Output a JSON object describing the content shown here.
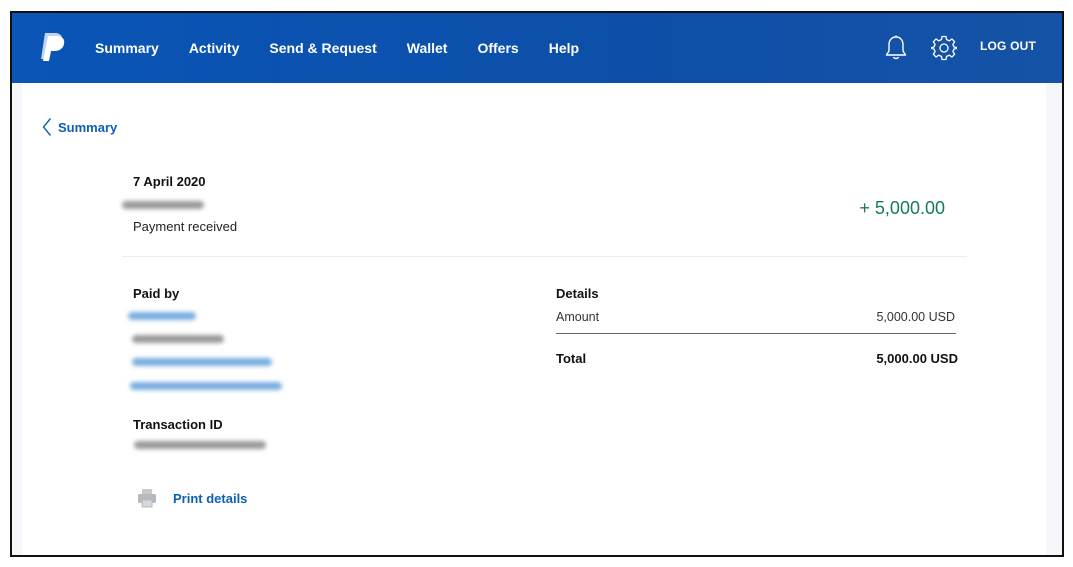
{
  "nav": {
    "items": [
      "Summary",
      "Activity",
      "Send & Request",
      "Wallet",
      "Offers",
      "Help"
    ],
    "logout_label": "LOG OUT"
  },
  "icons": {
    "logo": "paypal-logo-icon",
    "notifications": "bell-icon",
    "settings": "gear-icon",
    "back": "chevron-left-icon",
    "print": "printer-icon"
  },
  "colors": {
    "header": "#0a55b6",
    "link": "#0d5fb3",
    "amount_positive": "#177a5b"
  },
  "back_link": {
    "label": "Summary"
  },
  "transaction": {
    "date": "7 April 2020",
    "status": "Payment received",
    "amount": "+ 5,000.00"
  },
  "paid_by": {
    "label": "Paid by"
  },
  "transaction_id": {
    "label": "Transaction ID"
  },
  "details": {
    "label": "Details",
    "amount_label": "Amount",
    "amount_value": "5,000.00 USD",
    "total_label": "Total",
    "total_value": "5,000.00 USD"
  },
  "print": {
    "label": "Print details"
  }
}
